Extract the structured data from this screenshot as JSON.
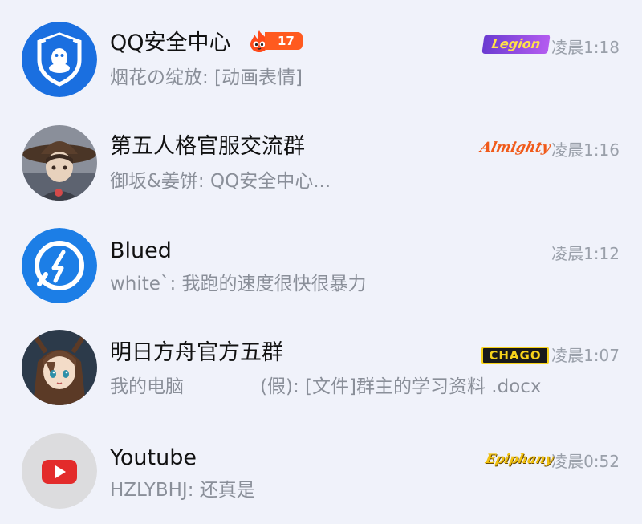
{
  "chats": [
    {
      "title": "QQ安全中心",
      "preview": "烟花の绽放: [动画表情]",
      "time": "凌晨1:18",
      "badge": "Legion",
      "hot_count": "17",
      "avatar": "shield-penguin-icon",
      "avatar_color": "#1a6fe0"
    },
    {
      "title": "第五人格官服交流群",
      "preview": "御坂&姜饼: QQ安全中心...",
      "time": "凌晨1:16",
      "badge": "Almighty",
      "avatar": "character-portrait"
    },
    {
      "title": "Blued",
      "preview": "white`: 我跑的速度很快很暴力",
      "time": "凌晨1:12",
      "avatar": "blued-logo-icon",
      "avatar_color": "#1c7ee6"
    },
    {
      "title": "明日方舟官方五群",
      "preview": "我的电脑             (假): [文件]群主的学习资料 .docx",
      "time": "凌晨1:07",
      "badge": "CHAGO",
      "avatar": "anime-character-portrait"
    },
    {
      "title": "Youtube",
      "preview": "HZLYBHJ: 还真是",
      "time": "凌晨0:52",
      "badge": "Epiphany",
      "avatar": "youtube-play-icon",
      "avatar_color": "#e32b2b"
    }
  ]
}
